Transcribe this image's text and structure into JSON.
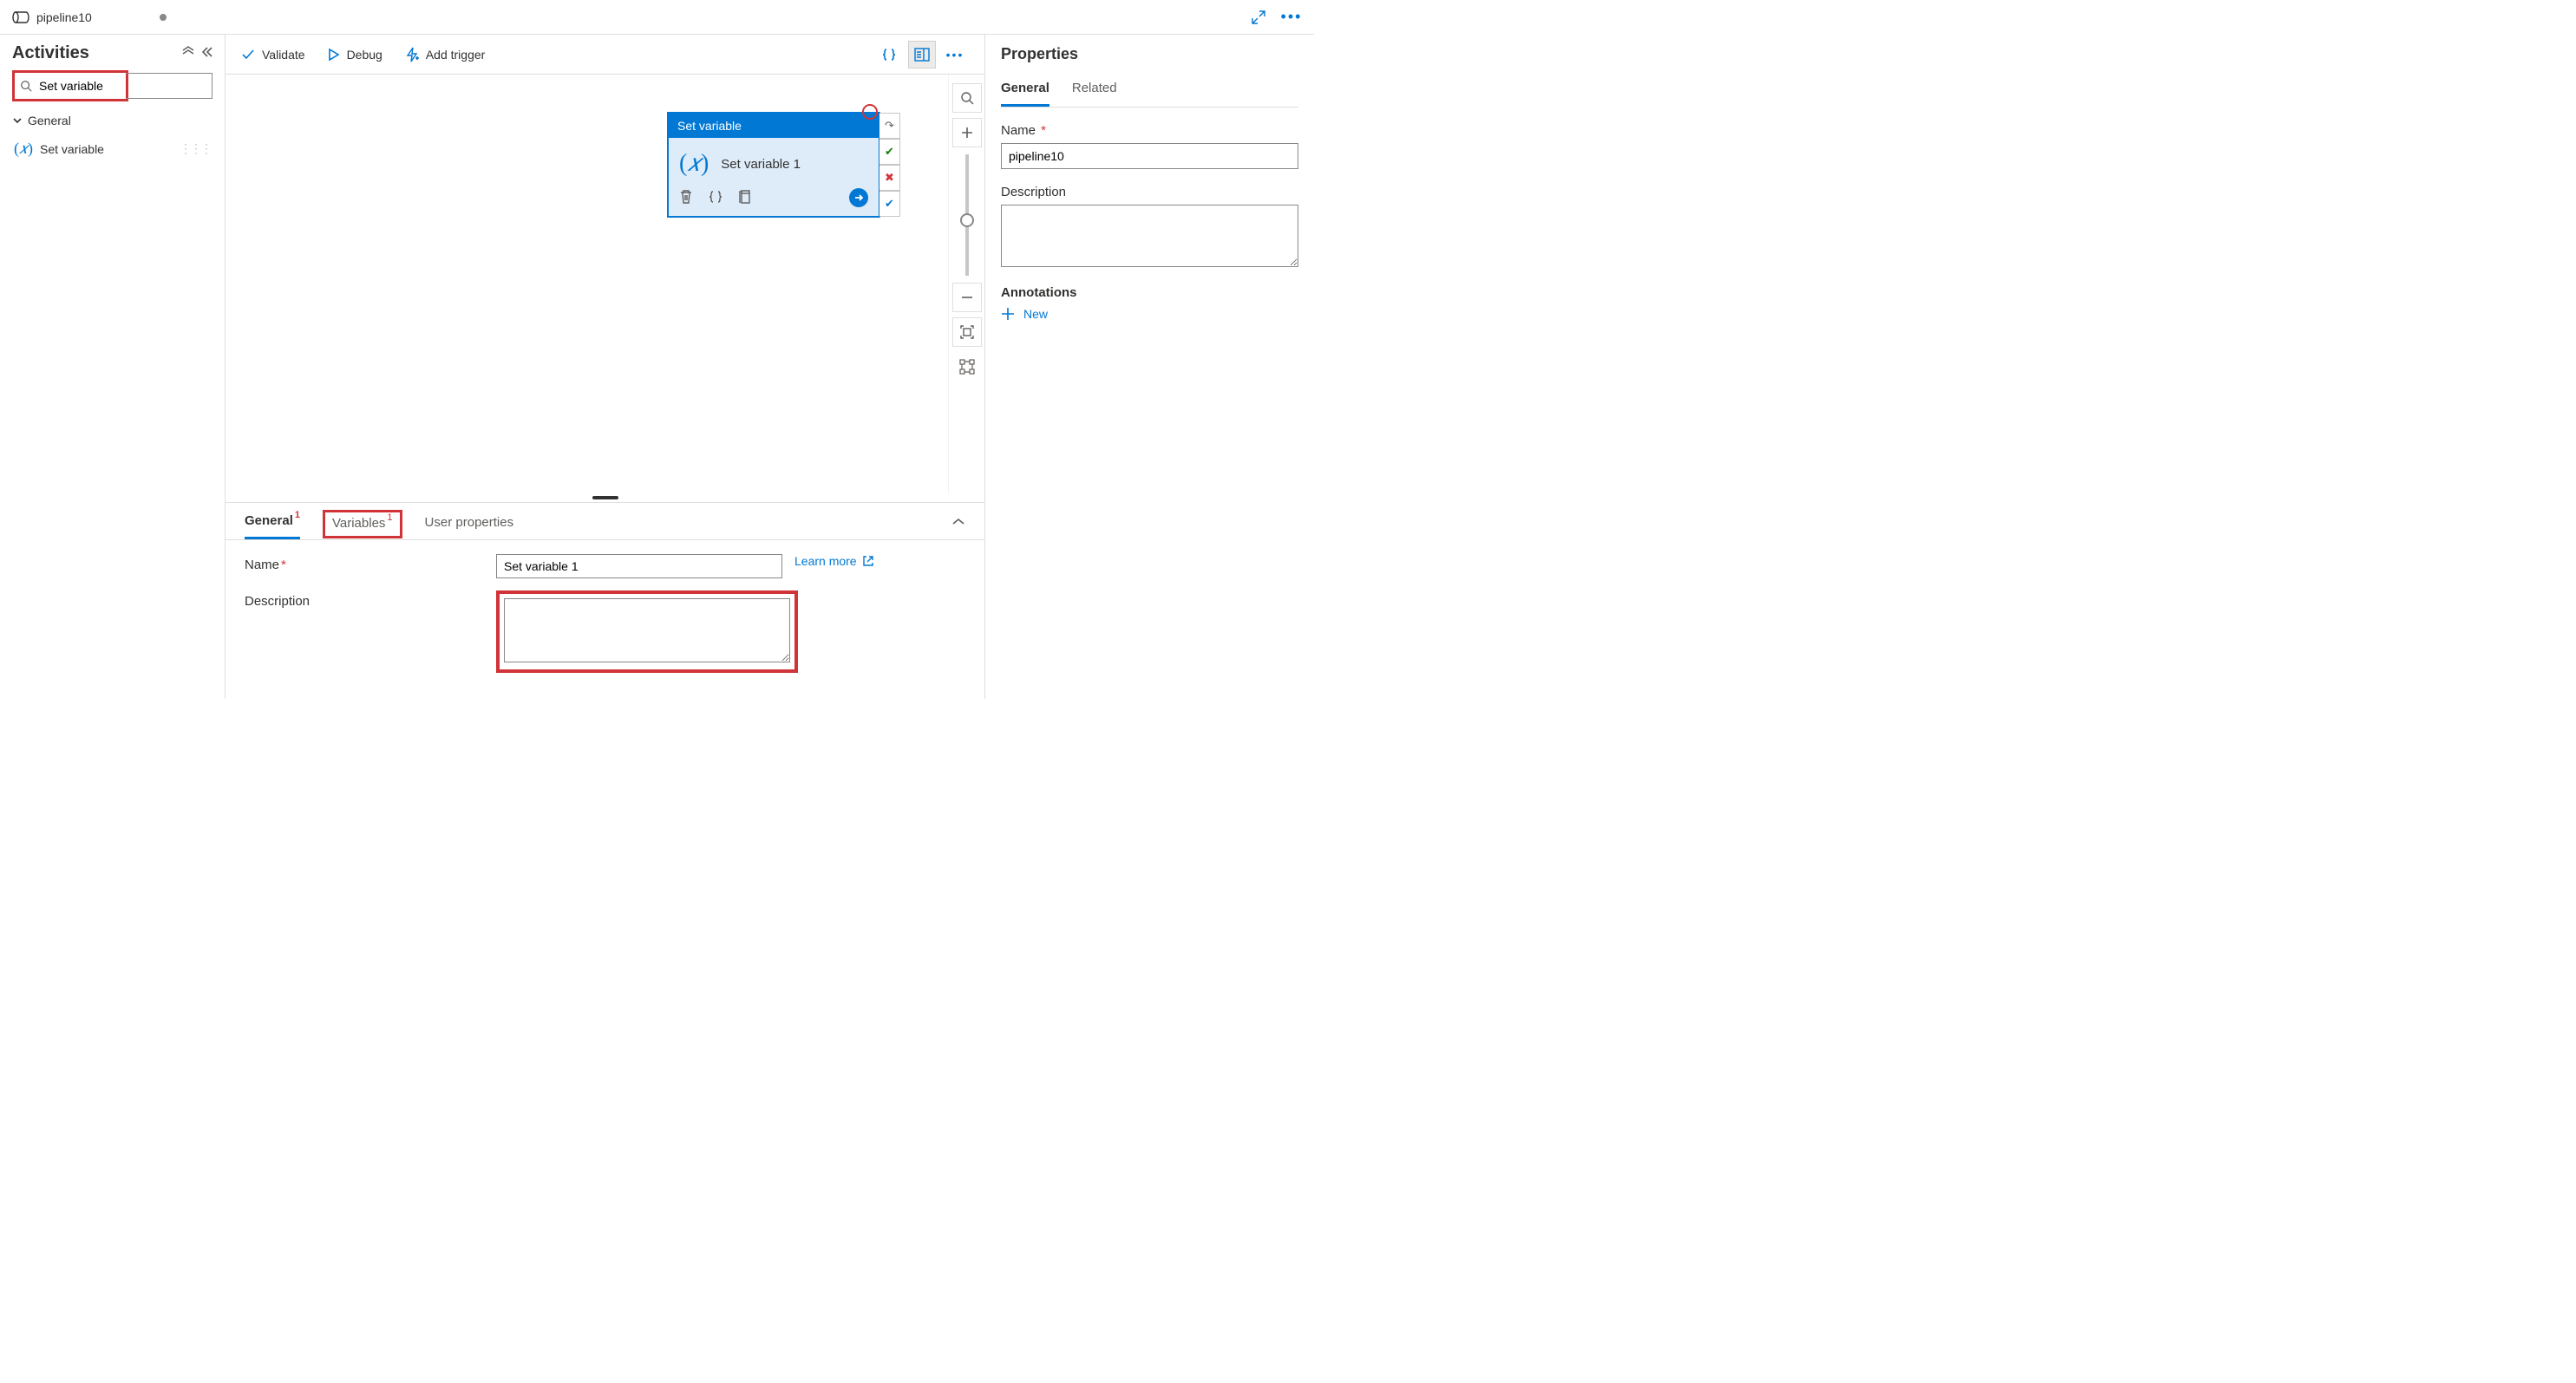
{
  "tab": {
    "title": "pipeline10"
  },
  "activities": {
    "title": "Activities",
    "search_value": "Set variable",
    "group": "General",
    "item": "Set variable"
  },
  "toolbar": {
    "validate": "Validate",
    "debug": "Debug",
    "add_trigger": "Add trigger"
  },
  "node": {
    "type": "Set variable",
    "name": "Set variable 1"
  },
  "bottom_tabs": {
    "general": "General",
    "general_badge": "1",
    "variables": "Variables",
    "variables_badge": "1",
    "user_props": "User properties",
    "name_label": "Name",
    "name_value": "Set variable 1",
    "desc_label": "Description",
    "desc_value": "",
    "learn_more": "Learn more"
  },
  "props": {
    "title": "Properties",
    "tab_general": "General",
    "tab_related": "Related",
    "name_label": "Name",
    "name_value": "pipeline10",
    "desc_label": "Description",
    "desc_value": "",
    "annotations_label": "Annotations",
    "new_label": "New"
  }
}
